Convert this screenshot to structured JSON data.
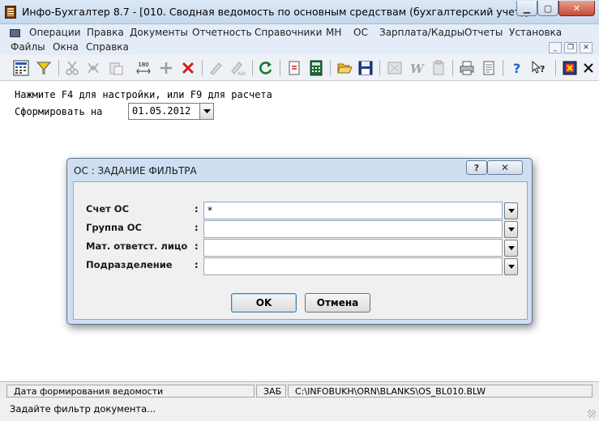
{
  "window": {
    "title": "Инфо-Бухгалтер 8.7 - [010. Сводная ведомость по основным средствам (бухгалтерский учет)]",
    "minimize_glyph": "▁",
    "maximize_glyph": "▢",
    "close_glyph": "✕"
  },
  "menu": {
    "row1": [
      "Операции",
      "Правка",
      "Документы",
      "Отчетность",
      "Справочники",
      "МН",
      "ОС",
      "Зарплата/Кадры",
      "Отчеты",
      "Установка"
    ],
    "row2": [
      "Файлы",
      "Окна",
      "Справка"
    ],
    "mdi_min": "_",
    "mdi_restore": "❐",
    "mdi_close": "✕"
  },
  "toolbar": {
    "icons": [
      "calculator-grid-icon",
      "filter-icon",
      "cut-icon",
      "copy-icon",
      "paste-icon",
      "number-180-icon",
      "add-icon",
      "delete-icon",
      "pen-icon",
      "pen-abc-icon",
      "refresh-icon",
      "document-new-icon",
      "calculator-icon",
      "folder-open-icon",
      "save-icon",
      "image-icon",
      "w-icon",
      "clipboard-icon",
      "print-icon",
      "preview-icon",
      "help-icon",
      "whats-this-icon",
      "exit-icon"
    ],
    "number_label": "180"
  },
  "content": {
    "hint_line": "Нажмите F4 для настройки, или F9 для расчета",
    "date_label": "Сформировать на",
    "date_value": "01.05.2012"
  },
  "dialog": {
    "title": "ОС : ЗАДАНИЕ ФИЛЬТРА",
    "help_glyph": "?",
    "close_glyph": "✕",
    "fields": [
      {
        "label": "Счет ОС",
        "value": "*"
      },
      {
        "label": "Группа ОС",
        "value": ""
      },
      {
        "label": "Мат. ответст. лицо",
        "value": ""
      },
      {
        "label": "Подразделение",
        "value": ""
      }
    ],
    "colon": ":",
    "ok_label": "OK",
    "cancel_label": "Отмена"
  },
  "statusbar": {
    "left": "Дата формирования ведомости",
    "mode": "ЗАБ",
    "path": "C:\\INFOBUKH\\ORN\\BLANKS\\OS_BL010.BLW",
    "hint": "Задайте фильтр документа..."
  }
}
